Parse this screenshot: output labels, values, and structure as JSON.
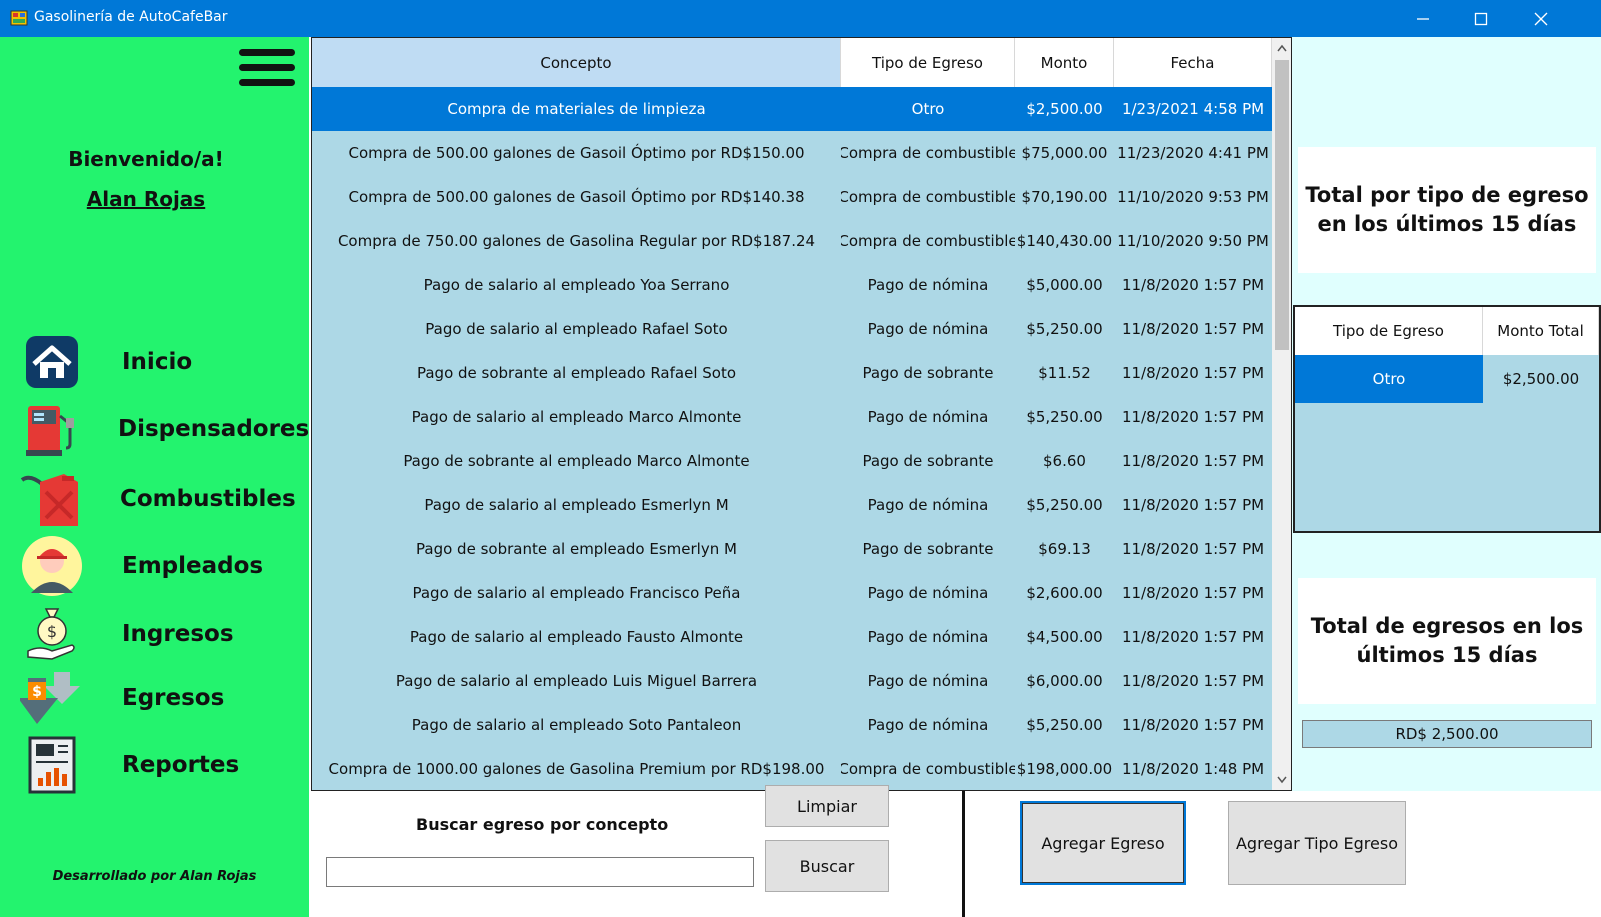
{
  "window": {
    "title": "Gasolinería de AutoCafeBar",
    "minimize": "—",
    "maximize": "☐",
    "close": "✕"
  },
  "colors": {
    "titlebar": "#0078d7",
    "sidebar": "#23f36e",
    "grid_bg": "#add8e6",
    "selection": "#0078d7",
    "right_panel": "#e0fffe"
  },
  "sidebar": {
    "menu_icon": "hamburger-menu-icon",
    "welcome": "Bienvenido/a!",
    "username": "Alan Rojas",
    "items": [
      {
        "label": "Inicio",
        "icon": "home-icon"
      },
      {
        "label": "Dispensadores",
        "icon": "fuel-pump-icon"
      },
      {
        "label": "Combustibles",
        "icon": "fuel-can-icon"
      },
      {
        "label": "Empleados",
        "icon": "employee-icon"
      },
      {
        "label": "Ingresos",
        "icon": "money-bag-hand-icon"
      },
      {
        "label": "Egresos",
        "icon": "down-arrows-money-icon"
      },
      {
        "label": "Reportes",
        "icon": "report-chart-icon"
      }
    ],
    "credit": "Desarrollado por Alan Rojas"
  },
  "grid": {
    "columns": [
      "Concepto",
      "Tipo de Egreso",
      "Monto",
      "Fecha"
    ],
    "rows": [
      [
        "Compra de materiales de limpieza",
        "Otro",
        "$2,500.00",
        "1/23/2021 4:58 PM"
      ],
      [
        "Compra de 500.00 galones de Gasoil Óptimo por RD$150.00",
        "Compra de combustible",
        "$75,000.00",
        "11/23/2020 4:41 PM"
      ],
      [
        "Compra de 500.00 galones de Gasoil Óptimo por RD$140.38",
        "Compra de combustible",
        "$70,190.00",
        "11/10/2020 9:53 PM"
      ],
      [
        "Compra de 750.00 galones de Gasolina Regular por RD$187.24",
        "Compra de combustible",
        "$140,430.00",
        "11/10/2020 9:50 PM"
      ],
      [
        "Pago de salario al empleado Yoa Serrano",
        "Pago de nómina",
        "$5,000.00",
        "11/8/2020 1:57 PM"
      ],
      [
        "Pago de salario al empleado Rafael Soto",
        "Pago de nómina",
        "$5,250.00",
        "11/8/2020 1:57 PM"
      ],
      [
        "Pago de sobrante al empleado Rafael Soto",
        "Pago de sobrante",
        "$11.52",
        "11/8/2020 1:57 PM"
      ],
      [
        "Pago de salario al empleado Marco Almonte",
        "Pago de nómina",
        "$5,250.00",
        "11/8/2020 1:57 PM"
      ],
      [
        "Pago de sobrante al empleado Marco Almonte",
        "Pago de sobrante",
        "$6.60",
        "11/8/2020 1:57 PM"
      ],
      [
        "Pago de salario al empleado Esmerlyn M",
        "Pago de nómina",
        "$5,250.00",
        "11/8/2020 1:57 PM"
      ],
      [
        "Pago de sobrante al empleado Esmerlyn M",
        "Pago de sobrante",
        "$69.13",
        "11/8/2020 1:57 PM"
      ],
      [
        "Pago de salario al empleado Francisco Peña",
        "Pago de nómina",
        "$2,600.00",
        "11/8/2020 1:57 PM"
      ],
      [
        "Pago de salario al empleado Fausto Almonte",
        "Pago de nómina",
        "$4,500.00",
        "11/8/2020 1:57 PM"
      ],
      [
        "Pago de salario al empleado Luis Miguel Barrera",
        "Pago de nómina",
        "$6,000.00",
        "11/8/2020 1:57 PM"
      ],
      [
        "Pago de salario al empleado Soto Pantaleon",
        "Pago de nómina",
        "$5,250.00",
        "11/8/2020 1:57 PM"
      ],
      [
        "Compra de 1000.00 galones de Gasolina Premium por RD$198.00",
        "Compra de combustible",
        "$198,000.00",
        "11/8/2020 1:48 PM"
      ]
    ],
    "selected_row": 0
  },
  "search": {
    "label": "Buscar egreso por concepto",
    "value": "",
    "clear_label": "Limpiar",
    "search_label": "Buscar"
  },
  "actions": {
    "add_expense": "Agregar Egreso",
    "add_expense_type": "Agregar Tipo Egreso"
  },
  "right": {
    "by_type_title": "Total por tipo de egreso en los últimos 15 días",
    "summary_columns": [
      "Tipo de Egreso",
      "Monto Total"
    ],
    "summary_rows": [
      [
        "Otro",
        "$2,500.00"
      ]
    ],
    "total_title": "Total de egresos en los últimos 15 días",
    "total_value": "RD$ 2,500.00"
  }
}
